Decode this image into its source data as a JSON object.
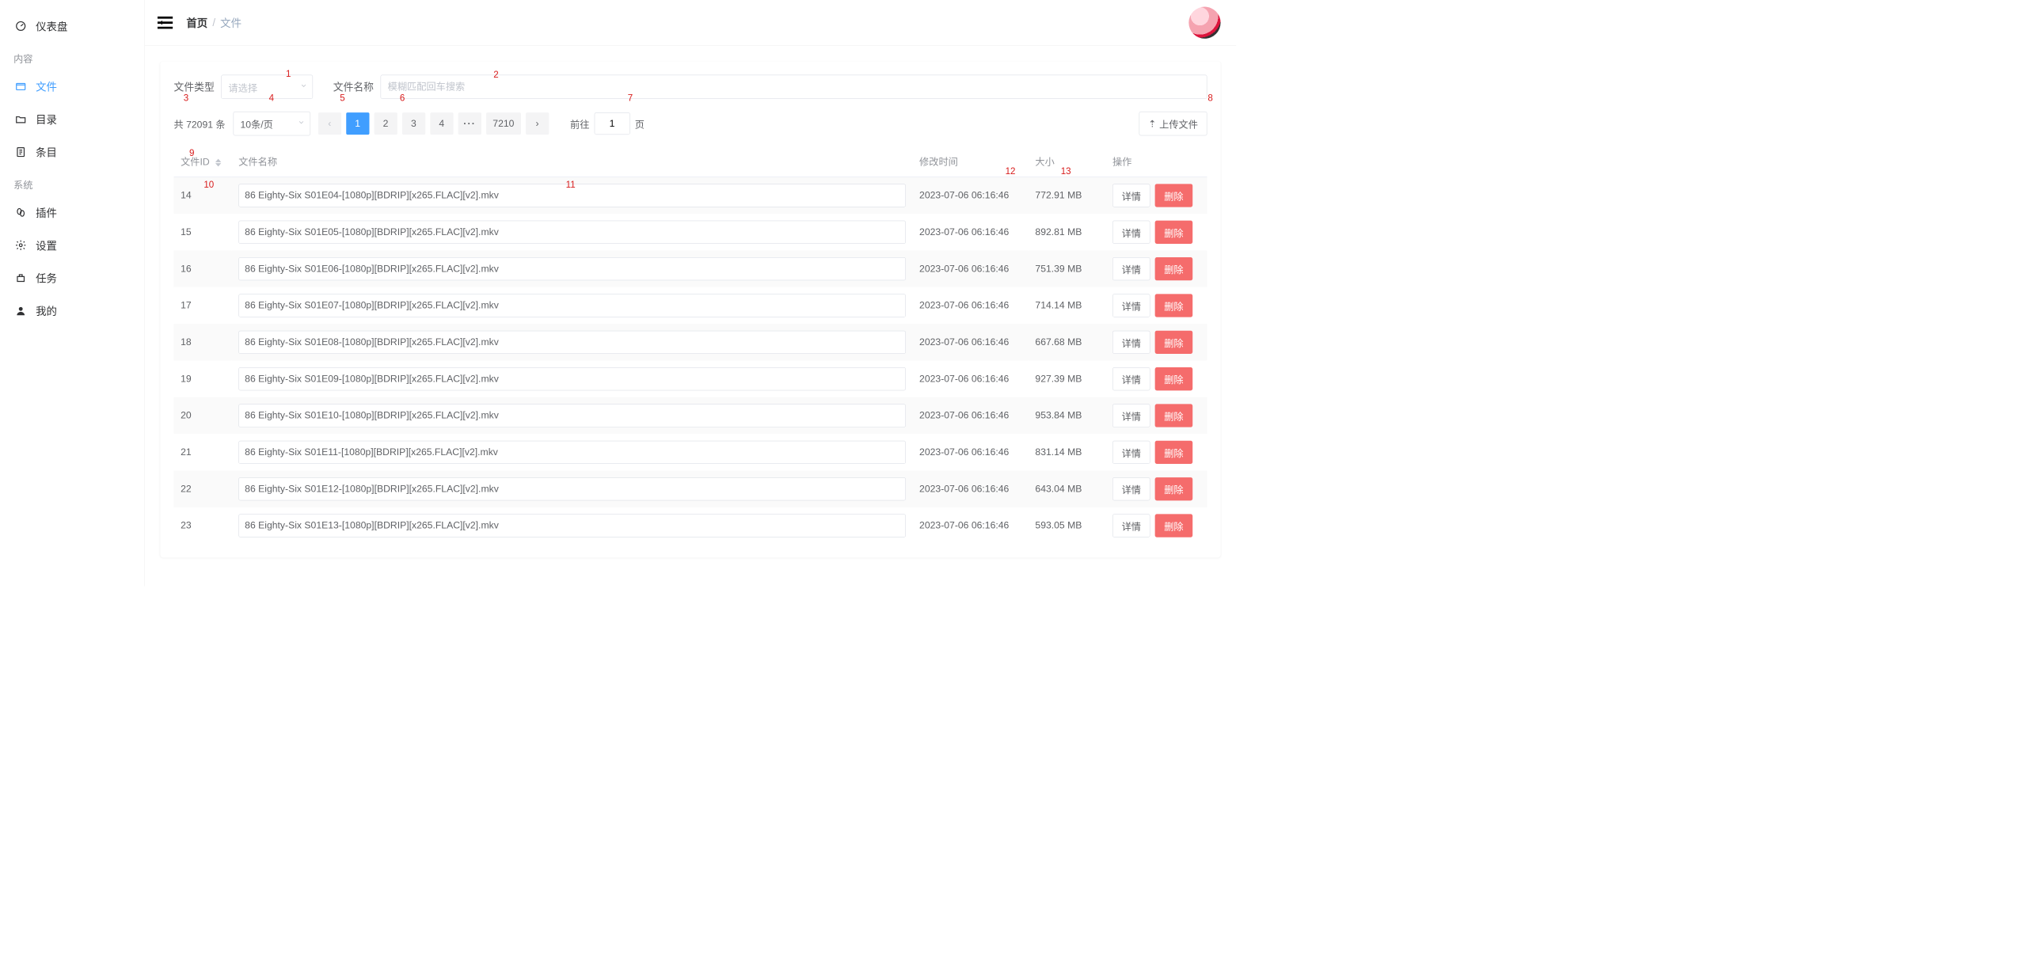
{
  "sidebar": {
    "dashboard": "仪表盘",
    "sections": {
      "content": "内容",
      "system": "系统"
    },
    "files": "文件",
    "directory": "目录",
    "entries": "条目",
    "plugins": "插件",
    "settings": "设置",
    "tasks": "任务",
    "my": "我的"
  },
  "breadcrumb": {
    "home": "首页",
    "current": "文件"
  },
  "filters": {
    "type_label": "文件类型",
    "type_placeholder": "请选择",
    "name_label": "文件名称",
    "name_placeholder": "模糊匹配回车搜索"
  },
  "pagination": {
    "total_text": "共 72091 条",
    "page_size": "10条/页",
    "pages": [
      "1",
      "2",
      "3",
      "4"
    ],
    "last_page": "7210",
    "goto_label": "前往",
    "goto_value": "1",
    "goto_suffix": "页"
  },
  "upload_btn": "上传文件",
  "columns": {
    "id": "文件ID",
    "name": "文件名称",
    "mtime": "修改时间",
    "size": "大小",
    "ops": "操作"
  },
  "ops": {
    "detail": "详情",
    "delete": "删除"
  },
  "rows": [
    {
      "id": "14",
      "name": "86 Eighty-Six S01E04-[1080p][BDRIP][x265.FLAC][v2].mkv",
      "mtime": "2023-07-06 06:16:46",
      "size": "772.91 MB"
    },
    {
      "id": "15",
      "name": "86 Eighty-Six S01E05-[1080p][BDRIP][x265.FLAC][v2].mkv",
      "mtime": "2023-07-06 06:16:46",
      "size": "892.81 MB"
    },
    {
      "id": "16",
      "name": "86 Eighty-Six S01E06-[1080p][BDRIP][x265.FLAC][v2].mkv",
      "mtime": "2023-07-06 06:16:46",
      "size": "751.39 MB"
    },
    {
      "id": "17",
      "name": "86 Eighty-Six S01E07-[1080p][BDRIP][x265.FLAC][v2].mkv",
      "mtime": "2023-07-06 06:16:46",
      "size": "714.14 MB"
    },
    {
      "id": "18",
      "name": "86 Eighty-Six S01E08-[1080p][BDRIP][x265.FLAC][v2].mkv",
      "mtime": "2023-07-06 06:16:46",
      "size": "667.68 MB"
    },
    {
      "id": "19",
      "name": "86 Eighty-Six S01E09-[1080p][BDRIP][x265.FLAC][v2].mkv",
      "mtime": "2023-07-06 06:16:46",
      "size": "927.39 MB"
    },
    {
      "id": "20",
      "name": "86 Eighty-Six S01E10-[1080p][BDRIP][x265.FLAC][v2].mkv",
      "mtime": "2023-07-06 06:16:46",
      "size": "953.84 MB"
    },
    {
      "id": "21",
      "name": "86 Eighty-Six S01E11-[1080p][BDRIP][x265.FLAC][v2].mkv",
      "mtime": "2023-07-06 06:16:46",
      "size": "831.14 MB"
    },
    {
      "id": "22",
      "name": "86 Eighty-Six S01E12-[1080p][BDRIP][x265.FLAC][v2].mkv",
      "mtime": "2023-07-06 06:16:46",
      "size": "643.04 MB"
    },
    {
      "id": "23",
      "name": "86 Eighty-Six S01E13-[1080p][BDRIP][x265.FLAC][v2].mkv",
      "mtime": "2023-07-06 06:16:46",
      "size": "593.05 MB"
    }
  ],
  "annotations": [
    "1",
    "2",
    "3",
    "4",
    "5",
    "6",
    "7",
    "8",
    "9",
    "10",
    "11",
    "12",
    "13"
  ]
}
